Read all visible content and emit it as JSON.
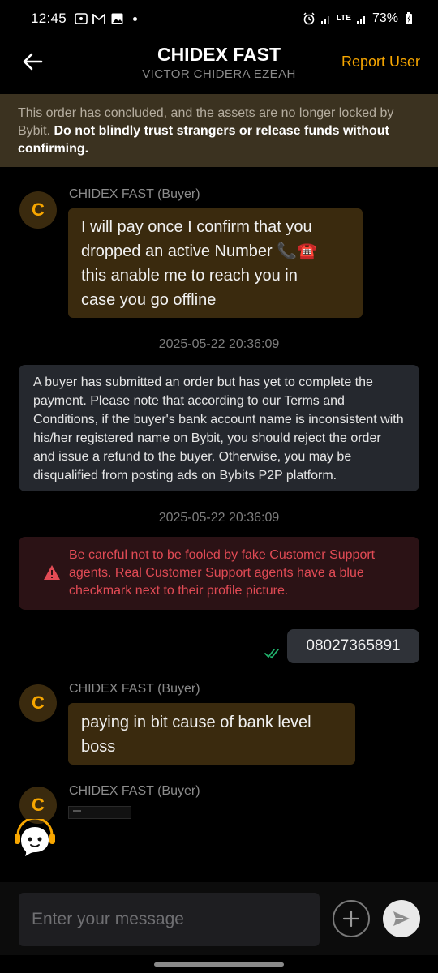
{
  "status_bar": {
    "time": "12:45",
    "network": "LTE",
    "battery": "73%",
    "icons_left": [
      "screen-record-icon",
      "gmail-icon",
      "gallery-icon",
      "notification-dot"
    ],
    "icons_right": [
      "alarm-icon",
      "signal-icon",
      "lte-icon",
      "signal-icon",
      "battery-icon"
    ]
  },
  "header": {
    "title": "CHIDEX FAST",
    "subtitle": "VICTOR CHIDERA EZEAH",
    "report_label": "Report User",
    "accent_color": "#f7a600"
  },
  "notice": {
    "text": "This order has concluded, and the assets are no longer locked by Bybit.",
    "bold_text": "Do not blindly trust strangers or release funds without confirming."
  },
  "messages": [
    {
      "sender": "CHIDEX FAST (Buyer)",
      "avatar_letter": "C",
      "lines": [
        "I will pay once I confirm that you",
        "dropped an active Number 📞☎️",
        "this anable me to reach you in",
        "case you go offline"
      ]
    },
    {
      "timestamp": "2025-05-22 20:36:09",
      "system_text": "A buyer has submitted an order but has yet to complete the payment. Please note that according to our Terms and Conditions, if the buyer's bank account name is inconsistent with his/her registered name on Bybit, you should reject the order and issue a refund to the buyer. Otherwise, you may be disqualified from posting ads on Bybits P2P platform."
    },
    {
      "timestamp": "2025-05-22 20:36:09",
      "warning_text": "Be careful not to be fooled by fake Customer Support agents. Real Customer Support agents have a blue checkmark next to their profile picture."
    },
    {
      "outgoing_text": "08027365891",
      "read_status": "read"
    },
    {
      "sender": "CHIDEX FAST (Buyer)",
      "avatar_letter": "C",
      "lines": [
        "paying in bit cause of bank level",
        "boss"
      ]
    },
    {
      "sender": "CHIDEX FAST (Buyer)",
      "avatar_letter": "C",
      "attachment": "image"
    }
  ],
  "input": {
    "placeholder": "Enter your message"
  },
  "colors": {
    "background": "#000000",
    "incoming_bubble": "#3a2a0e",
    "warning_text": "#e24b55",
    "check_color": "#20b26c"
  }
}
